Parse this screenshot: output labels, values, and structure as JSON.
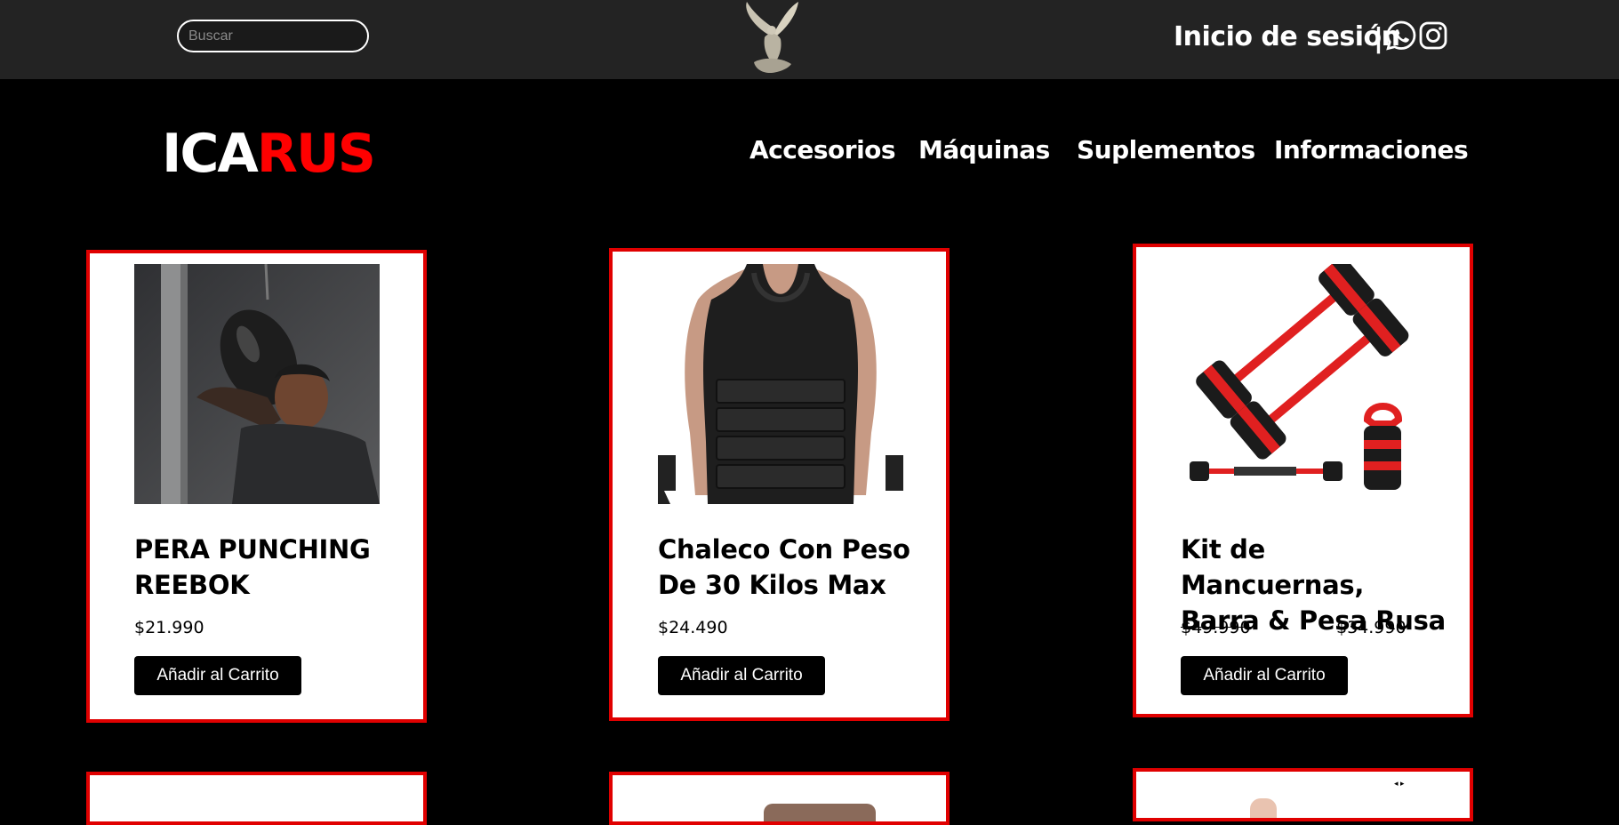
{
  "header": {
    "search_placeholder": "Buscar",
    "login_label": "Inicio de sesión",
    "separator": "|",
    "whatsapp_icon": "whatsapp-icon",
    "instagram_icon": "instagram-icon",
    "emblem_icon": "winged-angel-statue-icon"
  },
  "brand": {
    "part1": "ICA",
    "part2": "RUS"
  },
  "colors": {
    "accent": "#ff0000",
    "topbar": "#232323",
    "background": "#000000",
    "card_border": "#e00000"
  },
  "nav": {
    "items": [
      "Accesorios",
      "Máquinas",
      "Suplementos",
      "Informaciones"
    ]
  },
  "products": [
    {
      "title_line1": "PERA PUNCHING",
      "title_line2": "REEBOK",
      "price": "$21.990",
      "button": "Añadir al Carrito"
    },
    {
      "title_line1": "Chaleco Con Peso",
      "title_line2": "De 30 Kilos Max",
      "price": "$24.490",
      "button": "Añadir al Carrito"
    },
    {
      "title_line1": "Kit de Mancuernas,",
      "title_line2": "Barra & Pesa Rusa",
      "old_price": "$49.990",
      "price": "$34.990",
      "button": "Añadir al Carrito"
    }
  ]
}
